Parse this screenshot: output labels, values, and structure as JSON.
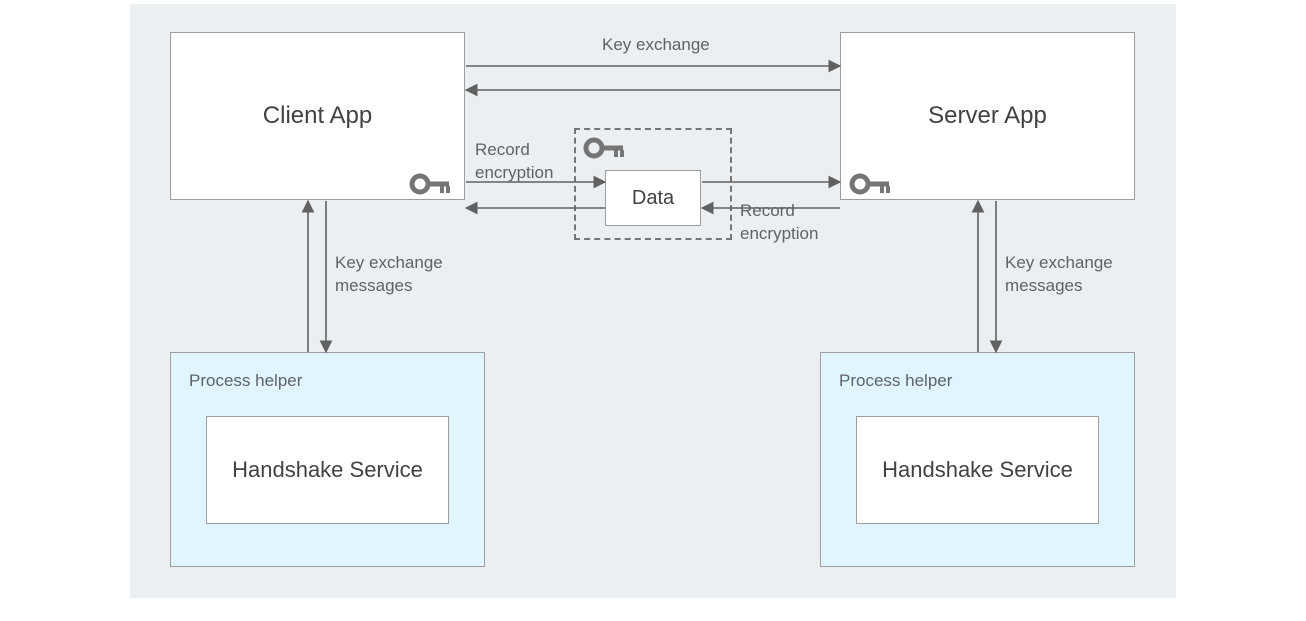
{
  "nodes": {
    "client_app": "Client App",
    "server_app": "Server App",
    "data": "Data",
    "handshake_service_left": "Handshake Service",
    "handshake_service_right": "Handshake Service",
    "process_helper_left": "Process helper",
    "process_helper_right": "Process helper"
  },
  "edges": {
    "key_exchange": "Key exchange",
    "record_encryption_left": "Record\nencryption",
    "record_encryption_right": "Record\nencryption",
    "key_exchange_messages_left": "Key exchange\nmessages",
    "key_exchange_messages_right": "Key exchange\nmessages"
  },
  "colors": {
    "background": "#eceff1",
    "box_border": "#9e9e9e",
    "box_fill": "#ffffff",
    "helper_fill": "#e1f5fe",
    "text_primary": "#424242",
    "text_secondary": "#5f6368",
    "arrow": "#616161",
    "key_icon": "#757575"
  }
}
